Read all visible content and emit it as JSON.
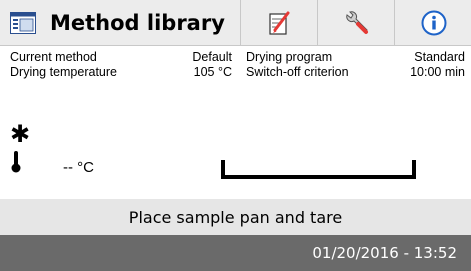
{
  "toolbar": {
    "title": "Method library",
    "main_icon": "method-library-icon",
    "edit_icon": "edit-icon",
    "tools_icon": "wrench-icon",
    "info_icon": "info-icon"
  },
  "method_info": {
    "current_method_label": "Current method",
    "current_method_value": "Default",
    "drying_program_label": "Drying program",
    "drying_program_value": "Standard",
    "drying_temperature_label": "Drying temperature",
    "drying_temperature_value": "105 °C",
    "switch_off_label": "Switch-off criterion",
    "switch_off_value": "10:00 min"
  },
  "status": {
    "asterisk": "✱",
    "temperature_reading": "-- °C"
  },
  "message": "Place sample pan and tare",
  "datetime": "01/20/2016 - 13:52",
  "colors": {
    "edit_accent": "#e53935",
    "tool_accent": "#1e63c8",
    "info_accent": "#1e63c8",
    "date_bar": "#6a6a6a"
  }
}
